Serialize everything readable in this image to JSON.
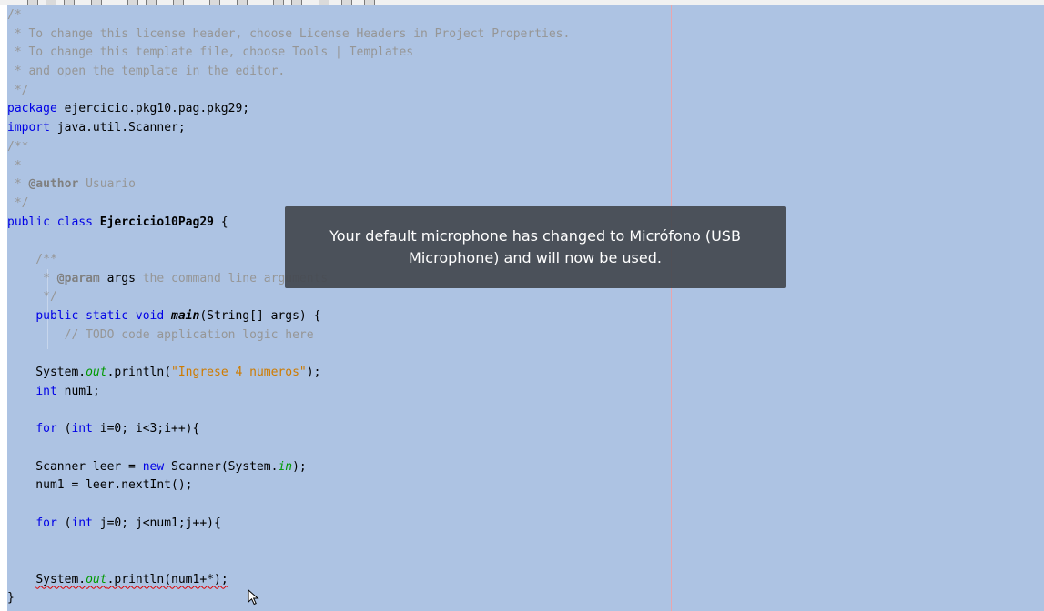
{
  "editor": {
    "lines": [
      [
        {
          "t": "/*",
          "c": "comment"
        }
      ],
      [
        {
          "t": " * To change this license header, choose License Headers in Project Properties.",
          "c": "comment"
        }
      ],
      [
        {
          "t": " * To change this template file, choose Tools | Templates",
          "c": "comment"
        }
      ],
      [
        {
          "t": " * and open the template in the editor.",
          "c": "comment"
        }
      ],
      [
        {
          "t": " */",
          "c": "comment"
        }
      ],
      [
        {
          "t": "package",
          "c": "kw"
        },
        {
          "t": " ejercicio.pkg10.pag.pkg29;",
          "c": "plain"
        }
      ],
      [
        {
          "t": "import",
          "c": "kw"
        },
        {
          "t": " java.util.Scanner;",
          "c": "plain"
        }
      ],
      [
        {
          "t": "/**",
          "c": "comment"
        }
      ],
      [
        {
          "t": " *",
          "c": "comment"
        }
      ],
      [
        {
          "t": " * ",
          "c": "comment"
        },
        {
          "t": "@author",
          "c": "ann"
        },
        {
          "t": " Usuario",
          "c": "comment"
        }
      ],
      [
        {
          "t": " */",
          "c": "comment"
        }
      ],
      [
        {
          "t": "public class",
          "c": "kw"
        },
        {
          "t": " ",
          "c": "plain"
        },
        {
          "t": "Ejercicio10Pag29",
          "c": "bold"
        },
        {
          "t": " {",
          "c": "plain"
        }
      ],
      [
        {
          "t": "",
          "c": "plain"
        }
      ],
      [
        {
          "t": "    /**",
          "c": "comment"
        }
      ],
      [
        {
          "t": "     * ",
          "c": "comment"
        },
        {
          "t": "@param",
          "c": "ann"
        },
        {
          "t": " args ",
          "c": "plain"
        },
        {
          "t": "the command line arguments",
          "c": "comment"
        }
      ],
      [
        {
          "t": "     */",
          "c": "comment"
        }
      ],
      [
        {
          "t": "    ",
          "c": "plain"
        },
        {
          "t": "public static void",
          "c": "kw"
        },
        {
          "t": " ",
          "c": "plain"
        },
        {
          "t": "main",
          "c": "bold-italic"
        },
        {
          "t": "(String[] args) {",
          "c": "plain"
        }
      ],
      [
        {
          "t": "        // TODO code application logic here",
          "c": "comment"
        }
      ],
      [
        {
          "t": "",
          "c": "plain"
        }
      ],
      [
        {
          "t": "    System.",
          "c": "plain"
        },
        {
          "t": "out",
          "c": "field"
        },
        {
          "t": ".println(",
          "c": "plain"
        },
        {
          "t": "\"Ingrese 4 numeros\"",
          "c": "str"
        },
        {
          "t": ");",
          "c": "plain"
        }
      ],
      [
        {
          "t": "    ",
          "c": "plain"
        },
        {
          "t": "int",
          "c": "kw"
        },
        {
          "t": " num1;",
          "c": "plain"
        }
      ],
      [
        {
          "t": "",
          "c": "plain"
        }
      ],
      [
        {
          "t": "    ",
          "c": "plain"
        },
        {
          "t": "for",
          "c": "kw"
        },
        {
          "t": " (",
          "c": "plain"
        },
        {
          "t": "int",
          "c": "kw"
        },
        {
          "t": " i=0; i<3;i++){",
          "c": "plain"
        }
      ],
      [
        {
          "t": "",
          "c": "plain"
        }
      ],
      [
        {
          "t": "    Scanner leer = ",
          "c": "plain"
        },
        {
          "t": "new",
          "c": "kw"
        },
        {
          "t": " Scanner(System.",
          "c": "plain"
        },
        {
          "t": "in",
          "c": "field"
        },
        {
          "t": ");",
          "c": "plain"
        }
      ],
      [
        {
          "t": "    num1 = leer.nextInt();",
          "c": "plain"
        }
      ],
      [
        {
          "t": "",
          "c": "plain"
        }
      ],
      [
        {
          "t": "    ",
          "c": "plain"
        },
        {
          "t": "for",
          "c": "kw"
        },
        {
          "t": " (",
          "c": "plain"
        },
        {
          "t": "int",
          "c": "kw"
        },
        {
          "t": " j=0; j<num1;j++){",
          "c": "plain"
        }
      ],
      [
        {
          "t": "",
          "c": "plain"
        }
      ],
      [
        {
          "t": "",
          "c": "plain"
        }
      ],
      [
        {
          "t": "    ",
          "c": "plain"
        },
        {
          "t": "System.",
          "c": "plain squiggle"
        },
        {
          "t": "out",
          "c": "field squiggle"
        },
        {
          "t": ".println(num1+*);",
          "c": "plain squiggle"
        }
      ],
      [
        {
          "t": "}",
          "c": "plain"
        }
      ]
    ]
  },
  "notification": {
    "message": "Your default microphone has changed to Micrófono (USB Microphone) and will now be used."
  },
  "colors": {
    "selection_background": "#adc3e3",
    "keyword": "#0000e6",
    "string": "#ce7b00",
    "comment": "#969696",
    "field": "#009900",
    "toast_background": "#444850"
  },
  "icons": {
    "cursor": "mouse-pointer-icon"
  }
}
